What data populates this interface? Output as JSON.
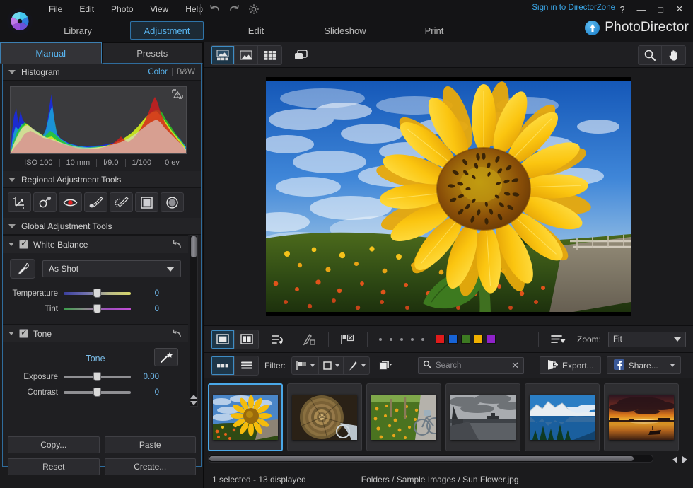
{
  "window": {
    "signin_label": "Sign in to DirectorZone",
    "help_glyph": "?",
    "minimize_glyph": "—",
    "maximize_glyph": "□",
    "close_glyph": "✕",
    "brand_name": "PhotoDirector"
  },
  "menu": {
    "items": [
      {
        "label": "File"
      },
      {
        "label": "Edit"
      },
      {
        "label": "Photo"
      },
      {
        "label": "View"
      },
      {
        "label": "Help"
      }
    ],
    "icons": [
      "undo-icon",
      "redo-icon",
      "preferences-gear-icon"
    ]
  },
  "modules": {
    "tabs": [
      {
        "label": "Library",
        "active": false
      },
      {
        "label": "Adjustment",
        "active": true
      },
      {
        "label": "Edit",
        "active": false
      },
      {
        "label": "Slideshow",
        "active": false
      },
      {
        "label": "Print",
        "active": false
      }
    ]
  },
  "left_panel": {
    "tabs": [
      {
        "label": "Manual",
        "active": true
      },
      {
        "label": "Presets",
        "active": false
      }
    ],
    "histogram": {
      "title": "Histogram",
      "mode_color": "Color",
      "mode_bw": "B&W",
      "warning_icon": "clipping-warning-icon",
      "exif": [
        {
          "label": "ISO 100"
        },
        {
          "label": "10 mm"
        },
        {
          "label": "f/9.0"
        },
        {
          "label": "1/100"
        },
        {
          "label": "0 ev"
        }
      ]
    },
    "regional": {
      "title": "Regional Adjustment Tools",
      "tools": [
        {
          "name": "crop-rotate-icon"
        },
        {
          "name": "blemish-removal-icon"
        },
        {
          "name": "red-eye-removal-icon"
        },
        {
          "name": "adjustment-brush-icon"
        },
        {
          "name": "adjustment-selection-brush-icon"
        },
        {
          "name": "gradient-mask-icon"
        },
        {
          "name": "radial-mask-icon"
        }
      ]
    },
    "global": {
      "title": "Global Adjustment Tools",
      "white_balance": {
        "title": "White Balance",
        "checked": true,
        "reset_icon": "reset-arrow-icon",
        "eyedropper_icon": "eyedropper-icon",
        "preset_value": "As Shot",
        "sliders": [
          {
            "label": "Temperature",
            "value": "0",
            "position": 50
          },
          {
            "label": "Tint",
            "value": "0",
            "position": 50
          }
        ]
      },
      "tone": {
        "title": "Tone",
        "checked": true,
        "reset_icon": "reset-arrow-icon",
        "section_label": "Tone",
        "wand_icon": "auto-tone-wand-icon",
        "sliders": [
          {
            "label": "Exposure",
            "value": "0.00",
            "position": 50
          },
          {
            "label": "Contrast",
            "value": "0",
            "position": 50
          }
        ]
      }
    },
    "buttons": [
      {
        "label": "Copy..."
      },
      {
        "label": "Paste"
      },
      {
        "label": "Reset"
      },
      {
        "label": "Create..."
      }
    ]
  },
  "view_toolbar": {
    "left_buttons": [
      {
        "name": "view-photo-with-filmstrip-icon",
        "active": true
      },
      {
        "name": "view-photo-only-icon",
        "active": false
      },
      {
        "name": "view-grid-icon",
        "active": false
      }
    ],
    "compare_button": {
      "name": "compare-before-after-icon"
    },
    "right_buttons": [
      {
        "name": "zoom-magnifier-icon"
      },
      {
        "name": "pan-hand-icon"
      }
    ]
  },
  "photo_toolbar": {
    "view_modes": [
      {
        "name": "single-view-icon",
        "active": true
      },
      {
        "name": "split-view-icon",
        "active": false
      }
    ],
    "icons": [
      {
        "name": "sort-order-icon"
      },
      {
        "name": "edit-tag-icon"
      },
      {
        "name": "flag-reject-icon"
      },
      {
        "name": "rating-filter-icon"
      },
      {
        "name": "sort-menu-icon"
      }
    ],
    "rating_dots": 5,
    "color_swatches": [
      {
        "name": "label-red",
        "color": "#e01b1b"
      },
      {
        "name": "label-blue",
        "color": "#1763d6"
      },
      {
        "name": "label-green",
        "color": "#3d7a22"
      },
      {
        "name": "label-yellow",
        "color": "#f0b000"
      },
      {
        "name": "label-purple",
        "color": "#8f22c9"
      }
    ],
    "zoom_label": "Zoom:",
    "zoom_value": "Fit"
  },
  "filter_bar": {
    "layout_buttons": [
      {
        "name": "thumbnail-view-icon",
        "active": true
      },
      {
        "name": "list-view-icon",
        "active": false
      }
    ],
    "filter_label": "Filter:",
    "filter_icons": [
      {
        "name": "flag-filter-icon"
      },
      {
        "name": "rating-filter-icon"
      },
      {
        "name": "edit-filter-icon"
      },
      {
        "name": "stack-filter-icon"
      }
    ],
    "search_placeholder": "Search",
    "search_value": "",
    "search_icon": "search-icon",
    "search_clear_glyph": "✕",
    "export_label": "Export...",
    "export_icon": "export-icon",
    "share_label": "Share...",
    "share_icon": "facebook-icon"
  },
  "filmstrip": {
    "items": [
      {
        "name": "thumbnail-sunflower",
        "selected": true
      },
      {
        "name": "thumbnail-spiral-staircase",
        "selected": false
      },
      {
        "name": "thumbnail-bicycle-field",
        "selected": false
      },
      {
        "name": "thumbnail-bw-pier",
        "selected": false
      },
      {
        "name": "thumbnail-mountain-lake",
        "selected": false
      },
      {
        "name": "thumbnail-sunset-harbor",
        "selected": false
      }
    ],
    "prev_glyph": "◀",
    "next_glyph": "▶"
  },
  "status_bar": {
    "selection": "1 selected - 13 displayed",
    "path": "Folders / Sample Images / Sun Flower.jpg"
  },
  "colors": {
    "accent": "#58b4ef",
    "link": "#3aa7e8",
    "panel_bg": "#1f1f22",
    "window_bg": "#1b1b1d"
  }
}
